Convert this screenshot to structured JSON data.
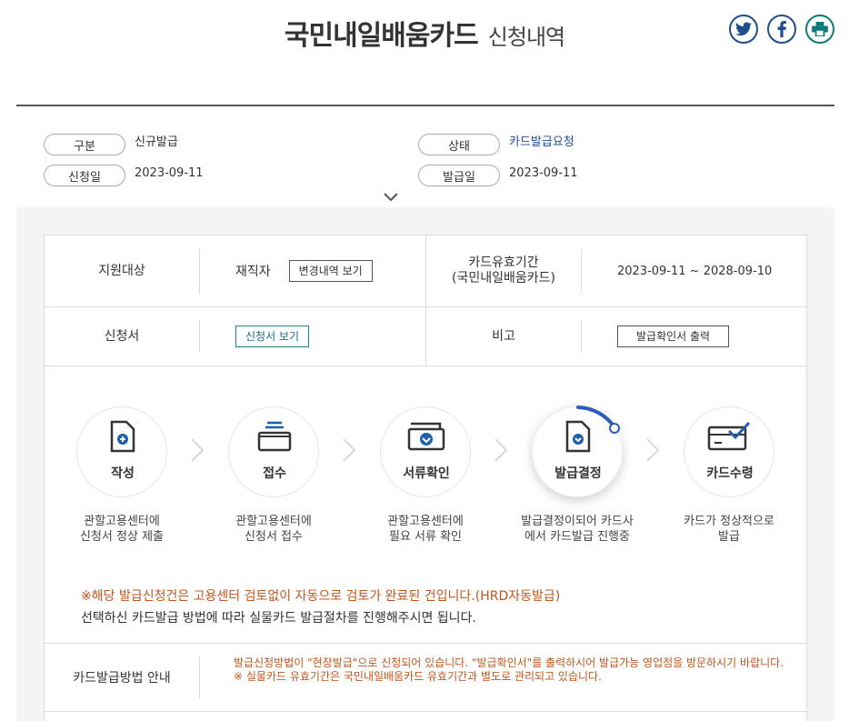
{
  "header": {
    "title": "국민내일배움카드",
    "subtitle": "신청내역",
    "share_buttons": [
      "twitter-icon",
      "facebook-icon",
      "print-icon"
    ]
  },
  "summary": {
    "type_label": "구분",
    "type_value": "신규발급",
    "status_label": "상태",
    "status_value": "카드발급요청",
    "apply_date_label": "신청일",
    "apply_date_value": "2023-09-11",
    "issue_date_label": "발급일",
    "issue_date_value": "2023-09-11"
  },
  "detail": {
    "target_label": "지원대상",
    "target_value": "재직자",
    "history_button": "변경내역 보기",
    "validity_label_line1": "카드유효기간",
    "validity_label_line2": "(국민내일배움카드)",
    "validity_value": "2023-09-11 ~ 2028-09-10",
    "application_label": "신청서",
    "application_button": "신청서 보기",
    "remark_label": "비고",
    "confirm_print_button": "발급확인서 출력"
  },
  "steps": [
    {
      "label": "작성",
      "desc1": "관할고용센터에",
      "desc2": "신청서 정상 제출",
      "icon": "document-plus-icon"
    },
    {
      "label": "접수",
      "desc1": "관할고용센터에",
      "desc2": "신청서 접수",
      "icon": "tray-icon"
    },
    {
      "label": "서류확인",
      "desc1": "관할고용센터에",
      "desc2": "필요 서류 확인",
      "icon": "folder-check-icon"
    },
    {
      "label": "발급결정",
      "desc1": "발급결정이되어 카드사",
      "desc2": "에서 카드발급 진행중",
      "icon": "document-check-icon",
      "active": true
    },
    {
      "label": "카드수령",
      "desc1": "카드가 정상적으로",
      "desc2": "발급",
      "icon": "card-check-icon"
    }
  ],
  "notice": {
    "line1": "※해당 발급신청건은 고용센터 검토없이 자동으로 검토가 완료된 건입니다.(HRD자동발급)",
    "line2": "선택하신 카드발급 방법에 따라 실물카드 발급절차를 진행해주시면 됩니다."
  },
  "method": {
    "label": "카드발급방법 안내",
    "text1": "발급신청방법이 \"현장발급\"으로 신청되어 있습니다. \"발급확인서\"를 출력하시어 발급가능 영업점을 방문하시기 바랍니다.",
    "text2": "※ 실물카드 유효기간은 국민내일배움카드 유효기간과 별도로 관리되고 있습니다."
  },
  "colors": {
    "accent_blue": "#1f4f9a",
    "notice_orange": "#c0571e",
    "progress_arc": "#2a5cb8"
  }
}
